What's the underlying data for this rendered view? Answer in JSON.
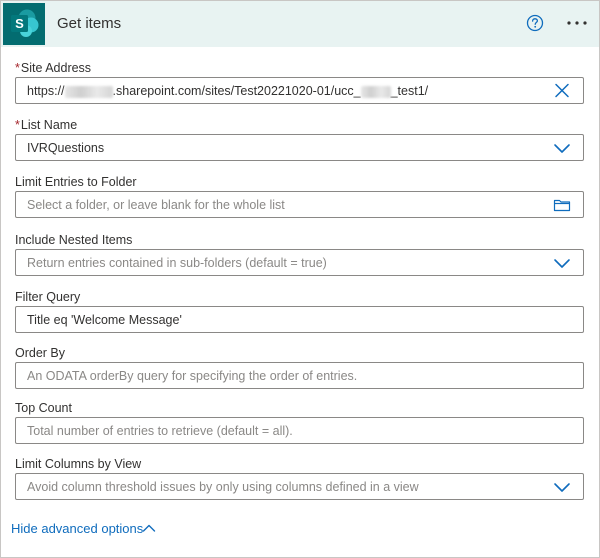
{
  "header": {
    "title": "Get items",
    "app_icon": "sharepoint-logo-icon",
    "help_icon": "help-circle-icon",
    "more_icon": "more-options-icon"
  },
  "fields": {
    "site_address": {
      "label": "Site Address",
      "required_marker": "*",
      "value_prefix": "https://",
      "value_middle": ".sharepoint.com/sites/Test20221020-01/ucc_",
      "value_suffix": "_test1/",
      "icon": "clear-x-icon"
    },
    "list_name": {
      "label": "List Name",
      "required_marker": "*",
      "value": "IVRQuestions",
      "icon": "chevron-down-icon"
    },
    "limit_entries": {
      "label": "Limit Entries to Folder",
      "placeholder": "Select a folder, or leave blank for the whole list",
      "icon": "folder-icon"
    },
    "nested_items": {
      "label": "Include Nested Items",
      "placeholder": "Return entries contained in sub-folders (default = true)",
      "icon": "chevron-down-icon"
    },
    "filter_query": {
      "label": "Filter Query",
      "value": "Title eq 'Welcome Message'"
    },
    "order_by": {
      "label": "Order By",
      "placeholder": "An ODATA orderBy query for specifying the order of entries."
    },
    "top_count": {
      "label": "Top Count",
      "placeholder": "Total number of entries to retrieve (default = all)."
    },
    "limit_columns": {
      "label": "Limit Columns by View",
      "placeholder": "Avoid column threshold issues by only using columns defined in a view",
      "icon": "chevron-down-icon"
    }
  },
  "footer": {
    "advanced_link": "Hide advanced options",
    "icon": "chevron-up-icon"
  },
  "colors": {
    "header_bg": "#e8f3f2",
    "sharepoint_teal": "#036c70",
    "accent_blue": "#0f6cbd",
    "required_red": "#a4262c"
  }
}
